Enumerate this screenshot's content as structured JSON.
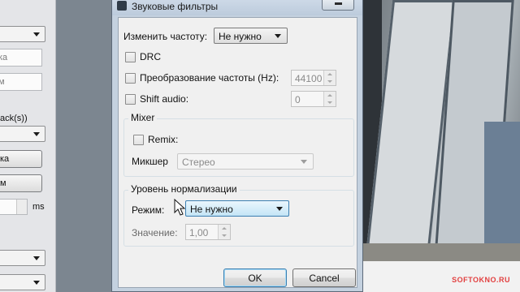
{
  "left_panel": {
    "input1_partial": "ка",
    "input2_partial": "м",
    "tracks_partial": "ack(s))",
    "button1_partial": "ка",
    "button2_partial": "м",
    "unit_label": "ms"
  },
  "dialog": {
    "title": "Звуковые фильтры",
    "resample": {
      "label": "Изменить частоту:",
      "value": "Не нужно"
    },
    "drc": {
      "label": "DRC",
      "checked": false
    },
    "freq_convert": {
      "label": "Преобразование частоты (Hz):",
      "checked": false,
      "value": "44100"
    },
    "shift_audio": {
      "label": "Shift audio:",
      "checked": false,
      "value": "0"
    },
    "mixer": {
      "title": "Mixer",
      "remix_label": "Remix:",
      "remix_checked": false,
      "mixer_label": "Микшер",
      "mixer_value": "Стерео"
    },
    "normalization": {
      "title": "Уровень нормализации",
      "mode_label": "Режим:",
      "mode_value": "Не нужно",
      "value_label": "Значение:",
      "value": "1,00"
    },
    "ok_label": "OK",
    "cancel_label": "Cancel"
  },
  "watermark": {
    "main": "SOFTOKNO",
    "suffix": ".RU"
  }
}
